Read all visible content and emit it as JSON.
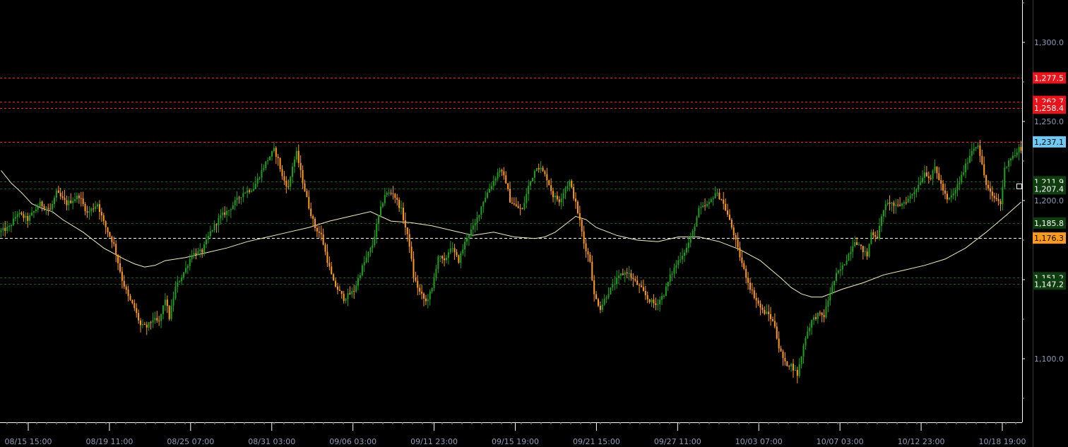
{
  "chart_data": {
    "type": "candlestick",
    "title": "",
    "ylim": [
      1070,
      1325
    ],
    "grid": false,
    "y_ticks": [
      {
        "value": 1100,
        "label": "1,100.0"
      },
      {
        "value": 1150,
        "label": "1,150.0"
      },
      {
        "value": 1200,
        "label": "1,200.0"
      },
      {
        "value": 1250,
        "label": "1,250.0"
      },
      {
        "value": 1300,
        "label": "1,300.0"
      }
    ],
    "x_labels": [
      "08/15 15:00",
      "08/19 11:00",
      "08/25 07:00",
      "08/31 03:00",
      "09/06 03:00",
      "09/11 23:00",
      "09/15 19:00",
      "09/21 15:00",
      "09/27 11:00",
      "10/03 07:00",
      "10/07 03:00",
      "10/12 23:00",
      "10/18 19:00"
    ],
    "levels": [
      {
        "value": 1277.5,
        "label": "1,277.5",
        "color": "#ff2020",
        "tag_bg": "#e8141c",
        "tag_fg": "#ffffff",
        "dash": "3,3"
      },
      {
        "value": 1262.7,
        "label": "1,262.7",
        "color": "#ff2020",
        "tag_bg": "#e8141c",
        "tag_fg": "#ffffff",
        "dash": "3,3"
      },
      {
        "value": 1258.4,
        "label": "1,258.4",
        "color": "#ff2020",
        "tag_bg": "#e8141c",
        "tag_fg": "#ffffff",
        "dash": "3,3"
      },
      {
        "value": 1237.1,
        "label": "1,237.1",
        "color": "#ff2020",
        "tag_bg": "#6ec8f5",
        "tag_fg": "#000000",
        "dash": "3,3"
      },
      {
        "value": 1211.9,
        "label": "1,211.9",
        "color": "#1d5a1d",
        "tag_bg": "#0f3d0f",
        "tag_fg": "#ffffff",
        "dash": "3,3"
      },
      {
        "value": 1207.4,
        "label": "1,207.4",
        "color": "#1d5a1d",
        "tag_bg": "#0f3d0f",
        "tag_fg": "#ffffff",
        "dash": "3,3"
      },
      {
        "value": 1185.8,
        "label": "1,185.8",
        "color": "#1d5a1d",
        "tag_bg": "#0f3d0f",
        "tag_fg": "#ffffff",
        "dash": "3,3"
      },
      {
        "value": 1176.3,
        "label": "1,176.3",
        "color": "#ffffff",
        "tag_bg": "#ff9a1a",
        "tag_fg": "#000000",
        "dash": "4,3"
      },
      {
        "value": 1151.2,
        "label": "1,151.2",
        "color": "#1d5a1d",
        "tag_bg": "#0f3d0f",
        "tag_fg": "#ffffff",
        "dash": "3,3"
      },
      {
        "value": 1147.2,
        "label": "1,147.2",
        "color": "#1d5a1d",
        "tag_bg": "#0f3d0f",
        "tag_fg": "#ffffff",
        "dash": "3,3"
      }
    ],
    "bull_color": "#1ea01e",
    "bear_color": "#ff9a1a",
    "ma_color": "#f5efc0",
    "price_path": [
      [
        0,
        1180
      ],
      [
        5,
        1183
      ],
      [
        9,
        1192
      ],
      [
        14,
        1188
      ],
      [
        20,
        1198
      ],
      [
        25,
        1194
      ],
      [
        28,
        1205
      ],
      [
        33,
        1198
      ],
      [
        39,
        1203
      ],
      [
        43,
        1192
      ],
      [
        48,
        1198
      ],
      [
        51,
        1186
      ],
      [
        56,
        1172
      ],
      [
        60,
        1150
      ],
      [
        63,
        1139
      ],
      [
        66,
        1132
      ],
      [
        69,
        1121
      ],
      [
        72,
        1120
      ],
      [
        75,
        1125
      ],
      [
        78,
        1123
      ],
      [
        81,
        1138
      ],
      [
        83,
        1126
      ],
      [
        86,
        1145
      ],
      [
        91,
        1157
      ],
      [
        94,
        1166
      ],
      [
        99,
        1168
      ],
      [
        103,
        1180
      ],
      [
        108,
        1190
      ],
      [
        112,
        1194
      ],
      [
        115,
        1199
      ],
      [
        119,
        1205
      ],
      [
        124,
        1208
      ],
      [
        127,
        1216
      ],
      [
        130,
        1224
      ],
      [
        134,
        1232
      ],
      [
        136,
        1226
      ],
      [
        138,
        1215
      ],
      [
        141,
        1208
      ],
      [
        143,
        1222
      ],
      [
        145,
        1230
      ],
      [
        148,
        1212
      ],
      [
        151,
        1196
      ],
      [
        154,
        1183
      ],
      [
        157,
        1178
      ],
      [
        160,
        1162
      ],
      [
        163,
        1148
      ],
      [
        168,
        1138
      ],
      [
        173,
        1143
      ],
      [
        177,
        1158
      ],
      [
        182,
        1172
      ],
      [
        185,
        1190
      ],
      [
        188,
        1204
      ],
      [
        192,
        1205
      ],
      [
        196,
        1194
      ],
      [
        198,
        1183
      ],
      [
        200,
        1172
      ],
      [
        202,
        1152
      ],
      [
        205,
        1142
      ],
      [
        208,
        1136
      ],
      [
        211,
        1144
      ],
      [
        214,
        1165
      ],
      [
        217,
        1161
      ],
      [
        220,
        1171
      ],
      [
        224,
        1162
      ],
      [
        228,
        1177
      ],
      [
        232,
        1185
      ],
      [
        236,
        1200
      ],
      [
        240,
        1210
      ],
      [
        244,
        1220
      ],
      [
        247,
        1212
      ],
      [
        249,
        1200
      ],
      [
        252,
        1196
      ],
      [
        255,
        1194
      ],
      [
        258,
        1209
      ],
      [
        262,
        1222
      ],
      [
        264,
        1220
      ],
      [
        267,
        1214
      ],
      [
        270,
        1203
      ],
      [
        273,
        1200
      ],
      [
        276,
        1208
      ],
      [
        278,
        1212
      ],
      [
        281,
        1198
      ],
      [
        283,
        1187
      ],
      [
        285,
        1173
      ],
      [
        288,
        1162
      ],
      [
        290,
        1140
      ],
      [
        293,
        1132
      ],
      [
        296,
        1140
      ],
      [
        300,
        1148
      ],
      [
        303,
        1153
      ],
      [
        306,
        1155
      ],
      [
        309,
        1150
      ],
      [
        313,
        1144
      ],
      [
        316,
        1138
      ],
      [
        320,
        1134
      ],
      [
        324,
        1141
      ],
      [
        327,
        1152
      ],
      [
        331,
        1162
      ],
      [
        335,
        1170
      ],
      [
        338,
        1180
      ],
      [
        341,
        1194
      ],
      [
        346,
        1198
      ],
      [
        349,
        1205
      ],
      [
        352,
        1201
      ],
      [
        355,
        1191
      ],
      [
        358,
        1179
      ],
      [
        360,
        1169
      ],
      [
        363,
        1156
      ],
      [
        366,
        1145
      ],
      [
        369,
        1137
      ],
      [
        372,
        1130
      ],
      [
        375,
        1128
      ],
      [
        378,
        1121
      ],
      [
        380,
        1107
      ],
      [
        383,
        1097
      ],
      [
        386,
        1096
      ],
      [
        389,
        1090
      ],
      [
        391,
        1102
      ],
      [
        393,
        1114
      ],
      [
        396,
        1124
      ],
      [
        399,
        1128
      ],
      [
        402,
        1127
      ],
      [
        405,
        1142
      ],
      [
        408,
        1153
      ],
      [
        411,
        1158
      ],
      [
        414,
        1166
      ],
      [
        417,
        1175
      ],
      [
        420,
        1170
      ],
      [
        423,
        1165
      ],
      [
        425,
        1180
      ],
      [
        428,
        1177
      ],
      [
        431,
        1195
      ],
      [
        434,
        1199
      ],
      [
        437,
        1196
      ],
      [
        440,
        1198
      ],
      [
        443,
        1201
      ],
      [
        446,
        1206
      ],
      [
        448,
        1210
      ],
      [
        451,
        1218
      ],
      [
        454,
        1214
      ],
      [
        456,
        1221
      ],
      [
        459,
        1210
      ],
      [
        462,
        1200
      ],
      [
        465,
        1204
      ],
      [
        468,
        1212
      ],
      [
        471,
        1222
      ],
      [
        474,
        1232
      ],
      [
        477,
        1236
      ],
      [
        479,
        1222
      ],
      [
        481,
        1210
      ],
      [
        484,
        1202
      ],
      [
        486,
        1201
      ],
      [
        488,
        1198
      ],
      [
        490,
        1220
      ],
      [
        492,
        1226
      ],
      [
        494,
        1228
      ],
      [
        496,
        1230
      ],
      [
        497,
        1233
      ]
    ],
    "ma_path": [
      [
        0,
        1219
      ],
      [
        5,
        1211
      ],
      [
        10,
        1205
      ],
      [
        15,
        1198
      ],
      [
        20,
        1195
      ],
      [
        25,
        1193
      ],
      [
        30,
        1188
      ],
      [
        40,
        1180
      ],
      [
        50,
        1170
      ],
      [
        60,
        1163
      ],
      [
        65,
        1160
      ],
      [
        70,
        1158
      ],
      [
        75,
        1159
      ],
      [
        80,
        1162
      ],
      [
        90,
        1164
      ],
      [
        100,
        1167
      ],
      [
        110,
        1170
      ],
      [
        120,
        1174
      ],
      [
        130,
        1177
      ],
      [
        140,
        1180
      ],
      [
        150,
        1183
      ],
      [
        160,
        1187
      ],
      [
        170,
        1190
      ],
      [
        180,
        1193
      ],
      [
        190,
        1187
      ],
      [
        200,
        1186
      ],
      [
        210,
        1184
      ],
      [
        220,
        1181
      ],
      [
        230,
        1178
      ],
      [
        240,
        1180
      ],
      [
        250,
        1177
      ],
      [
        260,
        1176
      ],
      [
        265,
        1177
      ],
      [
        270,
        1180
      ],
      [
        275,
        1185
      ],
      [
        280,
        1190
      ],
      [
        285,
        1188
      ],
      [
        290,
        1183
      ],
      [
        300,
        1178
      ],
      [
        310,
        1175
      ],
      [
        320,
        1174
      ],
      [
        330,
        1177
      ],
      [
        340,
        1177
      ],
      [
        350,
        1174
      ],
      [
        360,
        1169
      ],
      [
        370,
        1162
      ],
      [
        380,
        1151
      ],
      [
        385,
        1145
      ],
      [
        390,
        1141
      ],
      [
        395,
        1139
      ],
      [
        400,
        1139
      ],
      [
        410,
        1144
      ],
      [
        420,
        1148
      ],
      [
        430,
        1153
      ],
      [
        440,
        1156
      ],
      [
        450,
        1159
      ],
      [
        460,
        1163
      ],
      [
        470,
        1170
      ],
      [
        480,
        1180
      ],
      [
        490,
        1191
      ],
      [
        497,
        1199
      ]
    ],
    "current_marker_value": 1209
  }
}
